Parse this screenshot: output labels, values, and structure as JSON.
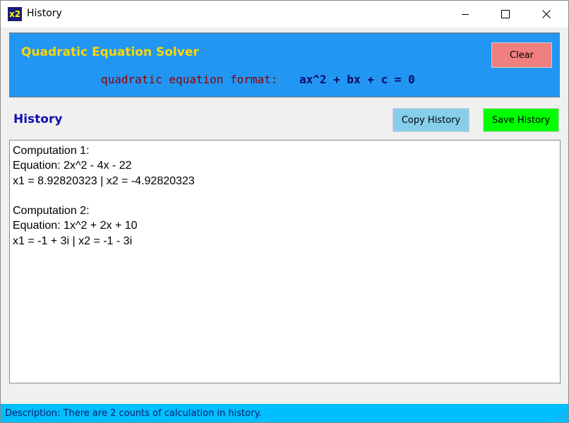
{
  "window": {
    "title": "History",
    "icon_text": "x2",
    "icon_name": "app-icon",
    "controls": [
      "minimize-icon",
      "maximize-icon",
      "close-icon"
    ]
  },
  "header": {
    "app_title": "Quadratic Equation Solver",
    "format_label": "quadratic equation format:",
    "format_value": "ax^2 + bx + c = 0",
    "clear_label": "Clear"
  },
  "history": {
    "title": "History",
    "copy_label": "Copy History",
    "save_label": "Save History",
    "lines": [
      "Computation 1:",
      "Equation: 2x^2 - 4x - 22",
      "x1 = 8.92820323 | x2 = -4.92820323",
      "",
      "Computation 2:",
      "Equation: 1x^2 + 2x + 10",
      "x1 = -1 + 3i | x2 = -1 - 3i"
    ]
  },
  "status": {
    "text": "Description: There are 2 counts of calculation in history."
  },
  "colors": {
    "header_bg": "#2196f3",
    "title_yellow": "#ffd700",
    "clear_bg": "#f08080",
    "copy_bg": "#87ceeb",
    "save_bg": "#00ff00",
    "status_bg": "#00bfff",
    "history_label": "#1010b0"
  }
}
